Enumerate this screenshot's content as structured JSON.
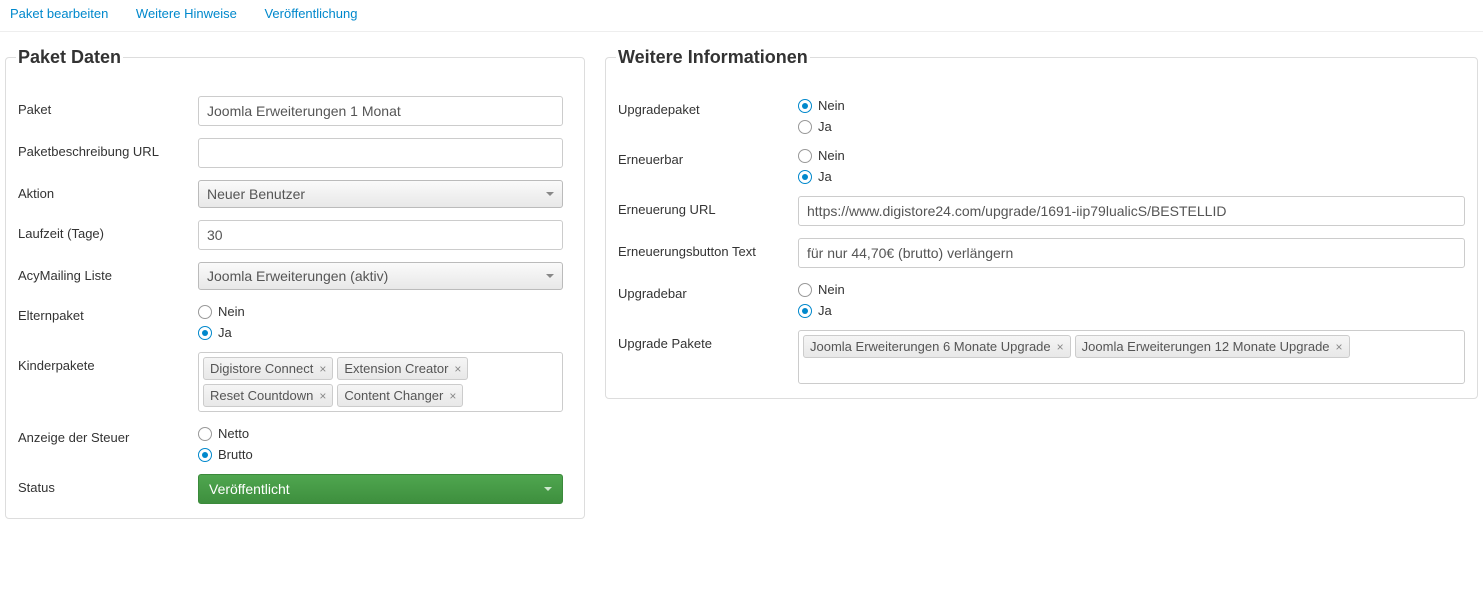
{
  "tabs": {
    "edit": "Paket bearbeiten",
    "hints": "Weitere Hinweise",
    "publish": "Veröffentlichung"
  },
  "left": {
    "legend": "Paket Daten",
    "paket_label": "Paket",
    "paket_value": "Joomla Erweiterungen 1 Monat",
    "desc_url_label": "Paketbeschreibung URL",
    "desc_url_value": "",
    "aktion_label": "Aktion",
    "aktion_value": "Neuer Benutzer",
    "laufzeit_label": "Laufzeit (Tage)",
    "laufzeit_value": "30",
    "acy_label": "AcyMailing Liste",
    "acy_value": "Joomla Erweiterungen (aktiv)",
    "eltern_label": "Elternpaket",
    "nein": "Nein",
    "ja": "Ja",
    "kinder_label": "Kinderpakete",
    "kinder_tags": {
      "t1": "Digistore Connect",
      "t2": "Extension Creator",
      "t3": "Reset Countdown",
      "t4": "Content Changer"
    },
    "steuer_label": "Anzeige der Steuer",
    "netto": "Netto",
    "brutto": "Brutto",
    "status_label": "Status",
    "status_value": "Veröffentlicht"
  },
  "right": {
    "legend": "Weitere Informationen",
    "upgrade_paket_label": "Upgradepaket",
    "erneuerbar_label": "Erneuerbar",
    "erneuerung_url_label": "Erneuerung URL",
    "erneuerung_url_value": "https://www.digistore24.com/upgrade/1691-iip79lualicS/BESTELLID",
    "erneuerung_btn_label": "Erneuerungsbutton Text",
    "erneuerung_btn_value": "für nur 44,70€ (brutto) verlängern",
    "upgradebar_label": "Upgradebar",
    "upgrade_pakete_label": "Upgrade Pakete",
    "upgrade_tags": {
      "t1": "Joomla Erweiterungen 6 Monate Upgrade",
      "t2": "Joomla Erweiterungen 12 Monate Upgrade"
    },
    "nein": "Nein",
    "ja": "Ja"
  }
}
